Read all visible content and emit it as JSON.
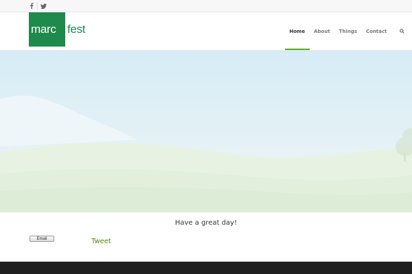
{
  "topbar": {
    "social": [
      {
        "icon": "facebook-icon"
      },
      {
        "icon": "twitter-icon"
      }
    ]
  },
  "logo": {
    "part1": "marc",
    "part2": "fest",
    "colors": {
      "brand": "#1e8a4b"
    }
  },
  "nav": {
    "items": [
      {
        "label": "Home"
      },
      {
        "label": "About"
      },
      {
        "label": "Things"
      },
      {
        "label": "Contact"
      }
    ],
    "active_index": 0,
    "accent": "#5aa626",
    "search_icon": "search-icon"
  },
  "main": {
    "tagline": "Have a great day!"
  },
  "share": {
    "email_label": "Email",
    "tweet_label": "Tweet"
  },
  "footer": {
    "color": "#202020"
  }
}
